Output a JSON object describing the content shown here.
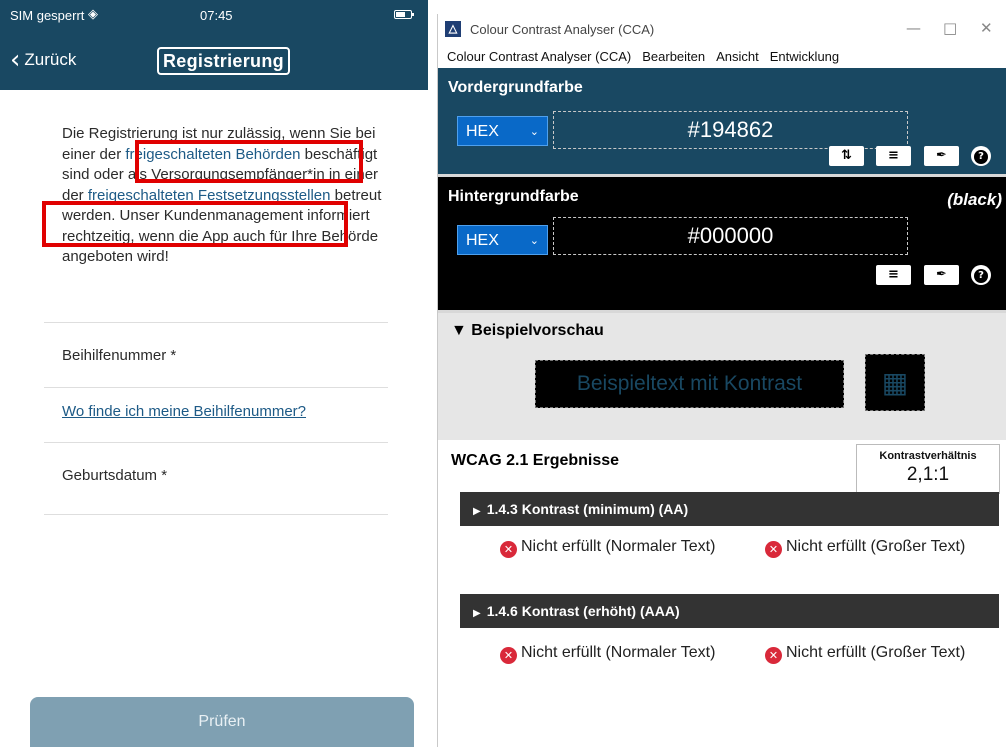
{
  "phone": {
    "status": {
      "carrier": "SIM gesperrt",
      "time": "07:45"
    },
    "nav": {
      "back_label": "Zurück",
      "title": "Registrierung"
    },
    "paragraph": {
      "p1": "Die Registrierung ist nur zulässig, wenn Sie bei einer der ",
      "link1": "freigeschalteten Behörden",
      "p2": " beschäftigt sind oder als Versorgungsempfänger*in in einer der ",
      "link2": "freigeschalteten Festsetzungsstellen",
      "p3": " betreut werden. Unser Kundenmanagement informiert rechtzeitig, wenn die App auch für Ihre Behörde angeboten wird!"
    },
    "fields": {
      "beihilfe_label": "Beihilfenummer *",
      "help_link": "Wo finde ich meine Beihilfenummer?",
      "birth_label": "Geburtsdatum *"
    },
    "submit_label": "Prüfen"
  },
  "cca": {
    "window_title": "Colour Contrast Analyser (CCA)",
    "menu": [
      "Colour Contrast Analyser (CCA)",
      "Bearbeiten",
      "Ansicht",
      "Entwicklung"
    ],
    "foreground": {
      "title": "Vordergrundfarbe",
      "format": "HEX",
      "value": "#194862",
      "color": "#194862"
    },
    "background": {
      "title": "Hintergrundfarbe",
      "name": "(black)",
      "format": "HEX",
      "value": "#000000",
      "color": "#000000"
    },
    "preview": {
      "title": "Beispielvorschau",
      "sample_text": "Beispieltext mit Kontrast"
    },
    "results": {
      "title": "WCAG 2.1 Ergebnisse",
      "ratio_label": "Kontrastverhältnis",
      "ratio_value": "2,1:1",
      "criteria": [
        {
          "name": "1.4.3 Kontrast (minimum) (AA)",
          "normal": "Nicht erfüllt (Normaler Text)",
          "large": "Nicht erfüllt (Großer Text)"
        },
        {
          "name": "1.4.6 Kontrast (erhöht) (AAA)",
          "normal": "Nicht erfüllt (Normaler Text)",
          "large": "Nicht erfüllt (Großer Text)"
        }
      ]
    }
  },
  "colors": {
    "app_primary": "#194862",
    "link": "#1d5a86",
    "highlight_red": "#e00000",
    "fail_red": "#d9293a",
    "hex_blue": "#0969c8"
  }
}
